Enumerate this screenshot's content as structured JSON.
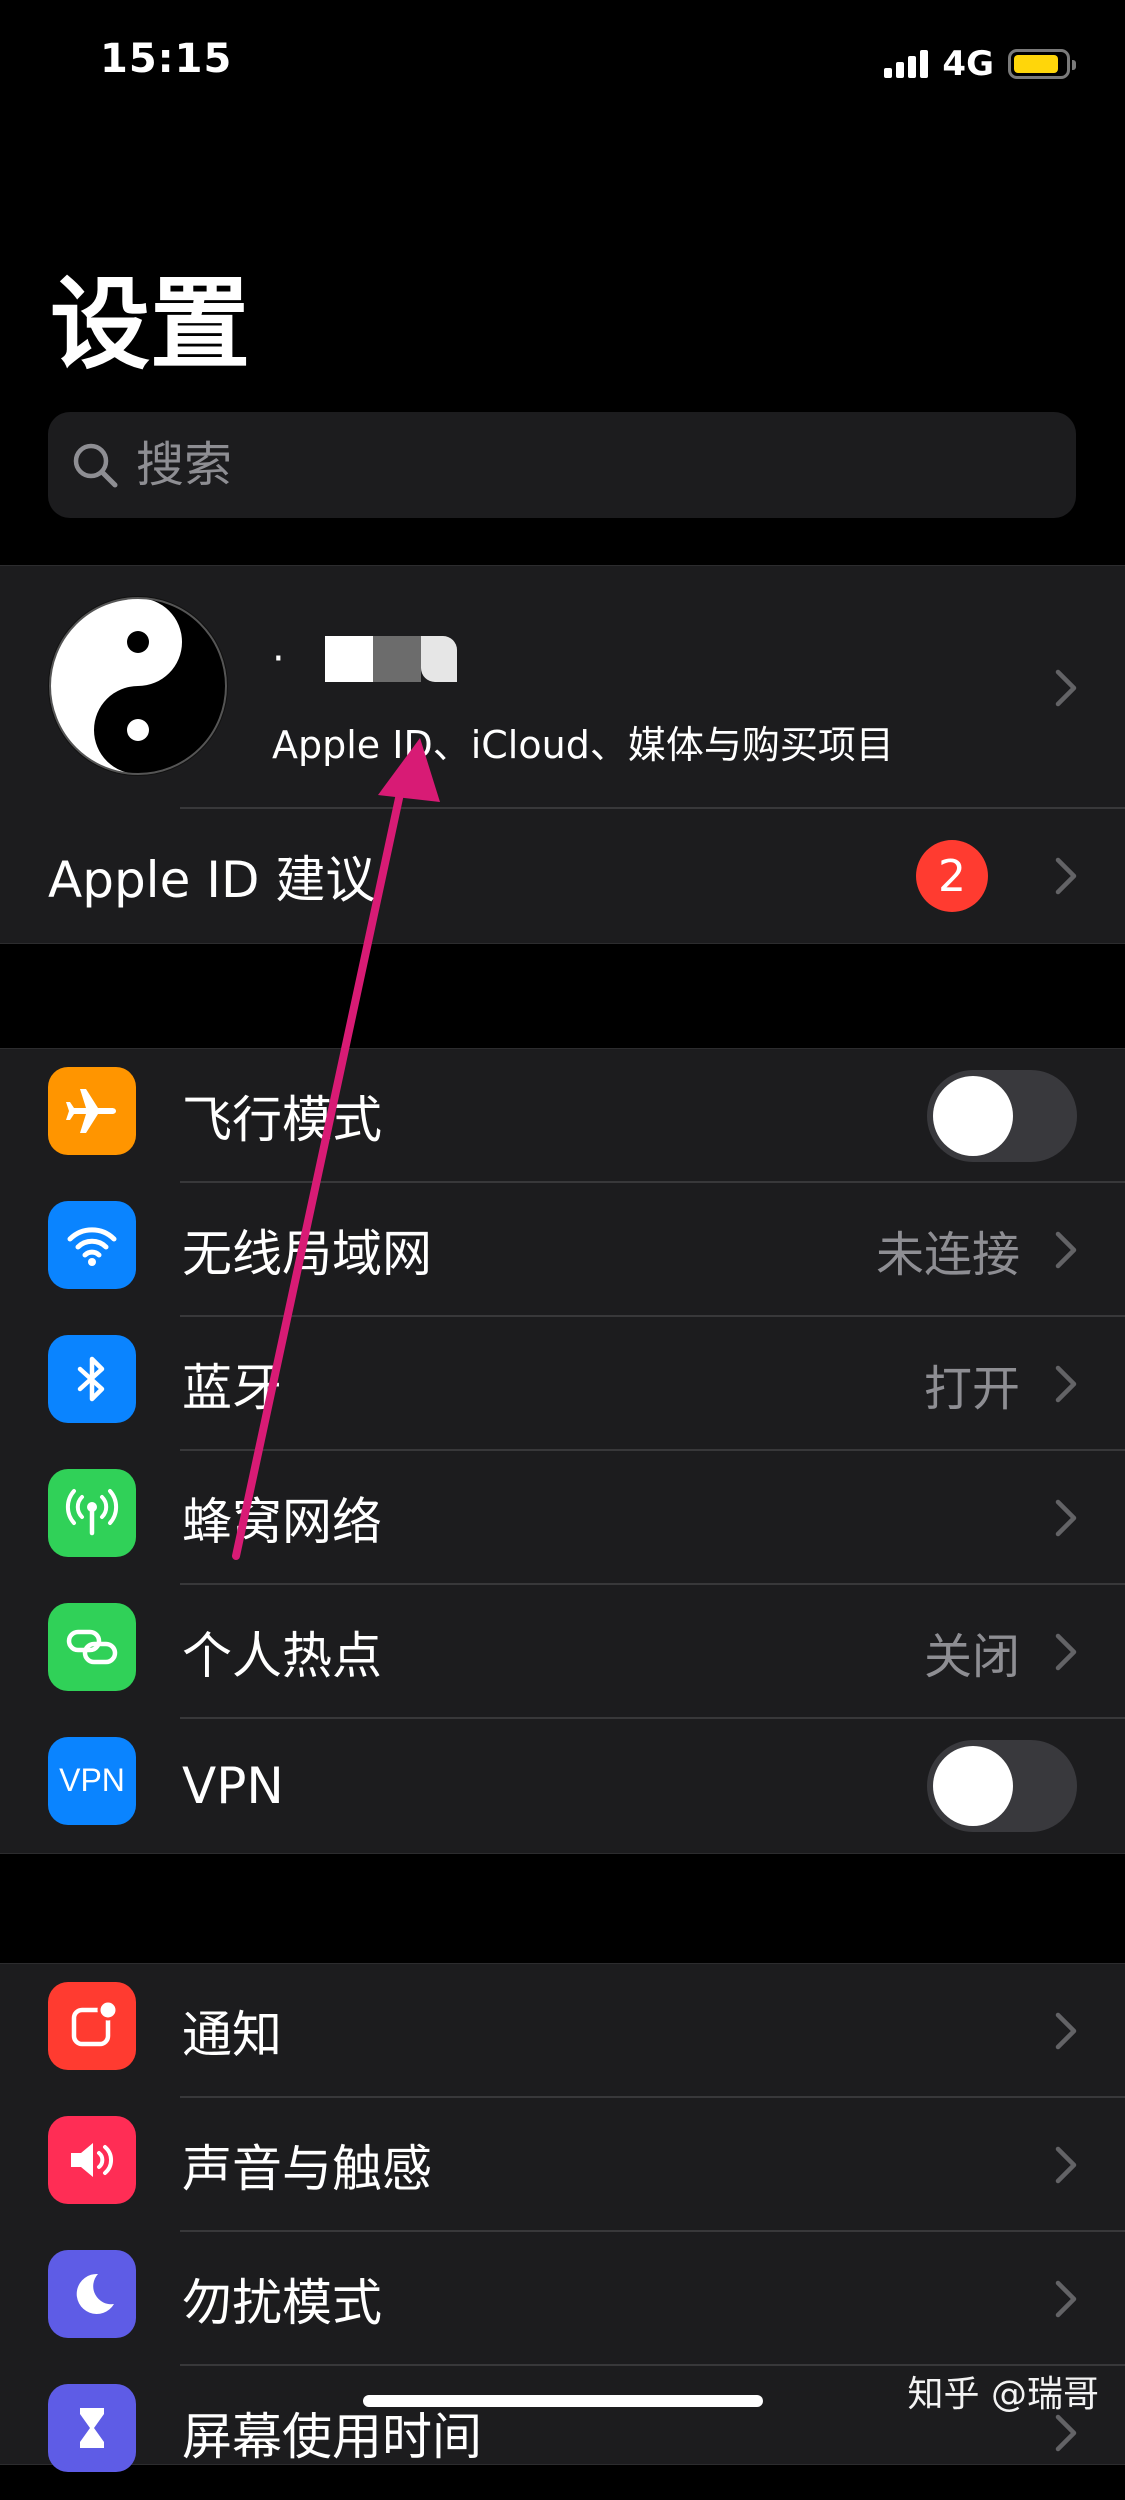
{
  "status_bar": {
    "time": "15:15",
    "network": "4G"
  },
  "page": {
    "title": "设置"
  },
  "search": {
    "placeholder": "搜索"
  },
  "profile": {
    "name_obscured": "·",
    "subtitle": "Apple ID、iCloud、媒体与购买项目"
  },
  "apple_id_suggestions": {
    "label": "Apple ID 建议",
    "badge": "2"
  },
  "connectivity": [
    {
      "label": "飞行模式",
      "icon": "airplane-icon",
      "color": "#ff9500",
      "toggle": false
    },
    {
      "label": "无线局域网",
      "icon": "wifi-icon",
      "color": "#0a84ff",
      "value": "未连接"
    },
    {
      "label": "蓝牙",
      "icon": "bluetooth-icon",
      "color": "#0a84ff",
      "value": "打开"
    },
    {
      "label": "蜂窝网络",
      "icon": "antenna-icon",
      "color": "#30d158",
      "value": ""
    },
    {
      "label": "个人热点",
      "icon": "hotspot-icon",
      "color": "#30d158",
      "value": "关闭"
    },
    {
      "label": "VPN",
      "icon": "vpn-icon",
      "icon_text": "VPN",
      "color": "#0a84ff",
      "toggle": false
    }
  ],
  "notifications_group": [
    {
      "label": "通知",
      "icon": "notification-icon",
      "color": "#ff3b30"
    },
    {
      "label": "声音与触感",
      "icon": "speaker-icon",
      "color": "#ff2d55"
    },
    {
      "label": "勿扰模式",
      "icon": "moon-icon",
      "color": "#5e5ce6"
    },
    {
      "label": "屏幕使用时间",
      "icon": "hourglass-icon",
      "color": "#5e5ce6"
    }
  ],
  "colors": {
    "background": "#000000",
    "cell": "#1c1c1e",
    "secondary_text": "#8e8e93",
    "annotation_arrow": "#d81b75"
  },
  "watermark": "知乎 @瑞哥"
}
